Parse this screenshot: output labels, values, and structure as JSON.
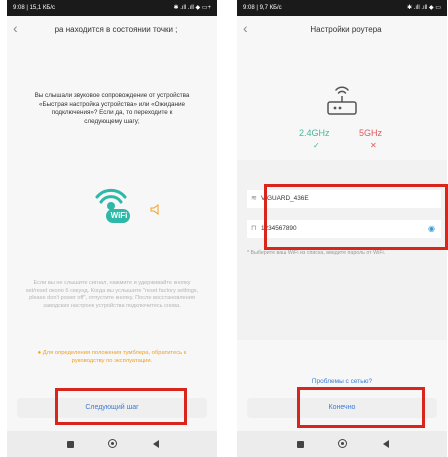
{
  "left": {
    "status": {
      "time": "9:08 | 15,1 КБ/с",
      "icons": "✱ .ıll .ıll ◆ ▭+"
    },
    "nav": {
      "title": "ра находится в состоянии точки ;"
    },
    "instruction": "Вы слышали звуковое сопровождение от устройства «Быстрая настройка устройства» или «Ожидание подключения»? Если да, то переходите к следующему шагу;",
    "icon_label": "WiFi",
    "hint": "Если вы не слышите сигнал, нажмите и удерживайте кнопку set/reset около 6 секунд. Когда вы услышите \"reset factory settings, please don't power off\", отпустите кнопку. После восстановления заводских настроек устройства подключитесь снова.",
    "note": "● Для определения положения тумблера, обратитесь к руководству по эксплуатации.",
    "button": "Следующий шаг"
  },
  "right": {
    "status": {
      "time": "9:08 | 9,7 КБ/с",
      "icons": "✱ .ıll .ıll ◆ ▭"
    },
    "nav": {
      "title": "Настройки роутера"
    },
    "bands": {
      "g24": "2.4GHz",
      "g5": "5GHz",
      "ok": "✓",
      "no": "✕"
    },
    "ssid": "VIGUARD_436E",
    "password": "1234567890",
    "hint": "* Выберите ваш WiFi из списка, введите пароль от WiFi.",
    "link": "Проблемы с сетью?",
    "button": "Конечно"
  },
  "colors": {
    "accent": "#3a7bd5",
    "band_ok": "#44b89b",
    "band_bad": "#e05a5a",
    "highlight": "#d9261c",
    "wifi_icon": "#2fb8a8",
    "speaker": "#f0a020"
  }
}
